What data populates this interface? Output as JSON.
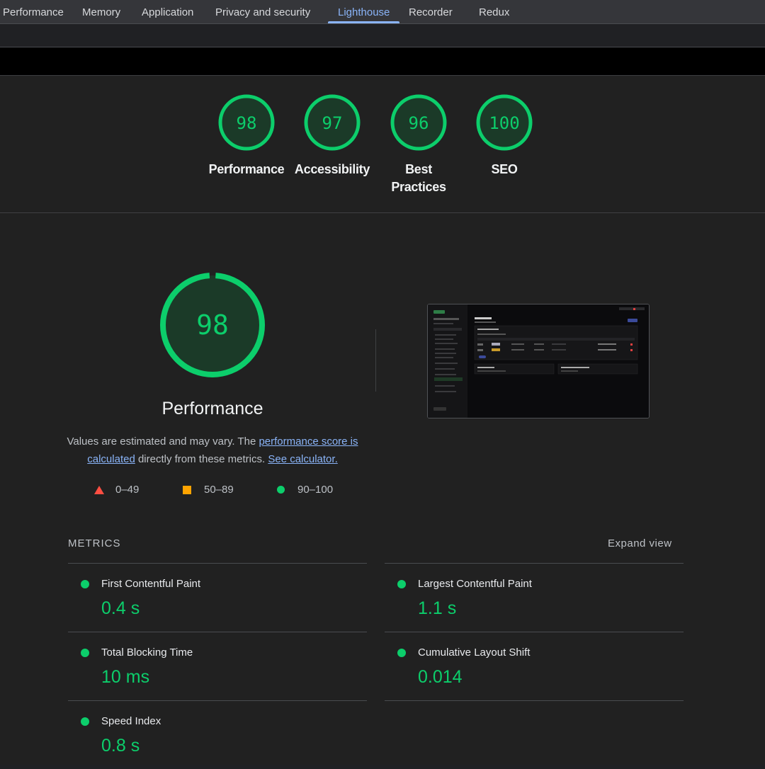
{
  "tabs": [
    {
      "label": "Performance"
    },
    {
      "label": "Memory"
    },
    {
      "label": "Application"
    },
    {
      "label": "Privacy and security"
    },
    {
      "label": "Lighthouse"
    },
    {
      "label": "Recorder"
    },
    {
      "label": "Redux"
    }
  ],
  "active_tab": "Lighthouse",
  "summary": {
    "gauges": [
      {
        "score": "98",
        "label": "Performance"
      },
      {
        "score": "97",
        "label": "Accessibility"
      },
      {
        "score": "96",
        "label_line1": "Best",
        "label_line2": "Practices"
      },
      {
        "score": "100",
        "label": "SEO"
      }
    ]
  },
  "performance": {
    "score": "98",
    "score_fraction": 0.98,
    "title": "Performance",
    "desc_prefix": "Values are estimated and may vary. The ",
    "desc_link1": "performance score is calculated",
    "desc_middle": " directly from these metrics. ",
    "desc_link2": "See calculator.",
    "legend": [
      {
        "range": "0–49",
        "shape": "triangle",
        "color": "#ff4e42"
      },
      {
        "range": "50–89",
        "shape": "square",
        "color": "#ffa400"
      },
      {
        "range": "90–100",
        "shape": "circle",
        "color": "#0cce6b"
      }
    ]
  },
  "metrics": {
    "title": "METRICS",
    "expand_label": "Expand view",
    "items": [
      {
        "name": "First Contentful Paint",
        "value": "0.4 s"
      },
      {
        "name": "Largest Contentful Paint",
        "value": "1.1 s"
      },
      {
        "name": "Total Blocking Time",
        "value": "10 ms"
      },
      {
        "name": "Cumulative Layout Shift",
        "value": "0.014"
      },
      {
        "name": "Speed Index",
        "value": "0.8 s"
      }
    ]
  },
  "colors": {
    "pass": "#0cce6b",
    "average": "#ffa400",
    "fail": "#ff4e42",
    "link": "#8ab4f8",
    "background": "#212121"
  }
}
